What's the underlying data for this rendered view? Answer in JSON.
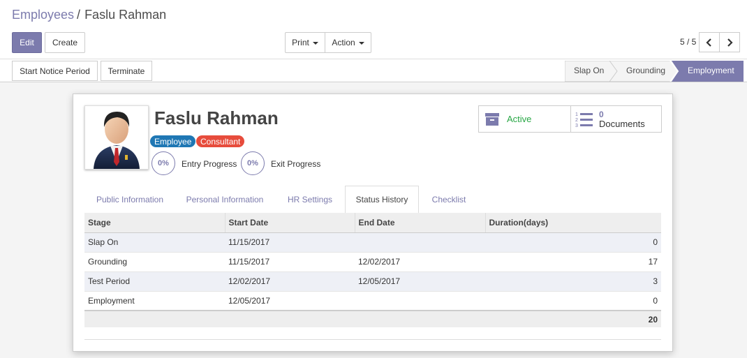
{
  "breadcrumb": {
    "parent": "Employees",
    "separator": "/",
    "current": "Faslu Rahman"
  },
  "toolbar": {
    "edit_label": "Edit",
    "create_label": "Create",
    "print_label": "Print",
    "action_label": "Action"
  },
  "pager": {
    "value": "5 / 5"
  },
  "statusbar": {
    "start_notice_label": "Start Notice Period",
    "terminate_label": "Terminate",
    "stages": [
      "Slap On",
      "Grounding",
      "Employment"
    ],
    "active_stage": "Employment"
  },
  "employee": {
    "name": "Faslu Rahman",
    "tags": [
      "Employee",
      "Consultant"
    ],
    "tag_colors": [
      "#1f77b4",
      "#e74c3c"
    ],
    "entry_progress_value": "0%",
    "entry_progress_label": "Entry Progress",
    "exit_progress_value": "0%",
    "exit_progress_label": "Exit Progress"
  },
  "smart_buttons": {
    "active_label": "Active",
    "documents_count": "0",
    "documents_label": "Documents"
  },
  "tabs": [
    "Public Information",
    "Personal Information",
    "HR Settings",
    "Status History",
    "Checklist"
  ],
  "active_tab": "Status History",
  "table": {
    "headers": [
      "Stage",
      "Start Date",
      "End Date",
      "Duration(days)"
    ],
    "rows": [
      [
        "Slap On",
        "11/15/2017",
        "",
        "0"
      ],
      [
        "Grounding",
        "11/15/2017",
        "12/02/2017",
        "17"
      ],
      [
        "Test Period",
        "12/02/2017",
        "12/05/2017",
        "3"
      ],
      [
        "Employment",
        "12/05/2017",
        "",
        "0"
      ]
    ],
    "total": "20"
  },
  "colors": {
    "primary": "#7c7bad",
    "active_green": "#28a745"
  }
}
